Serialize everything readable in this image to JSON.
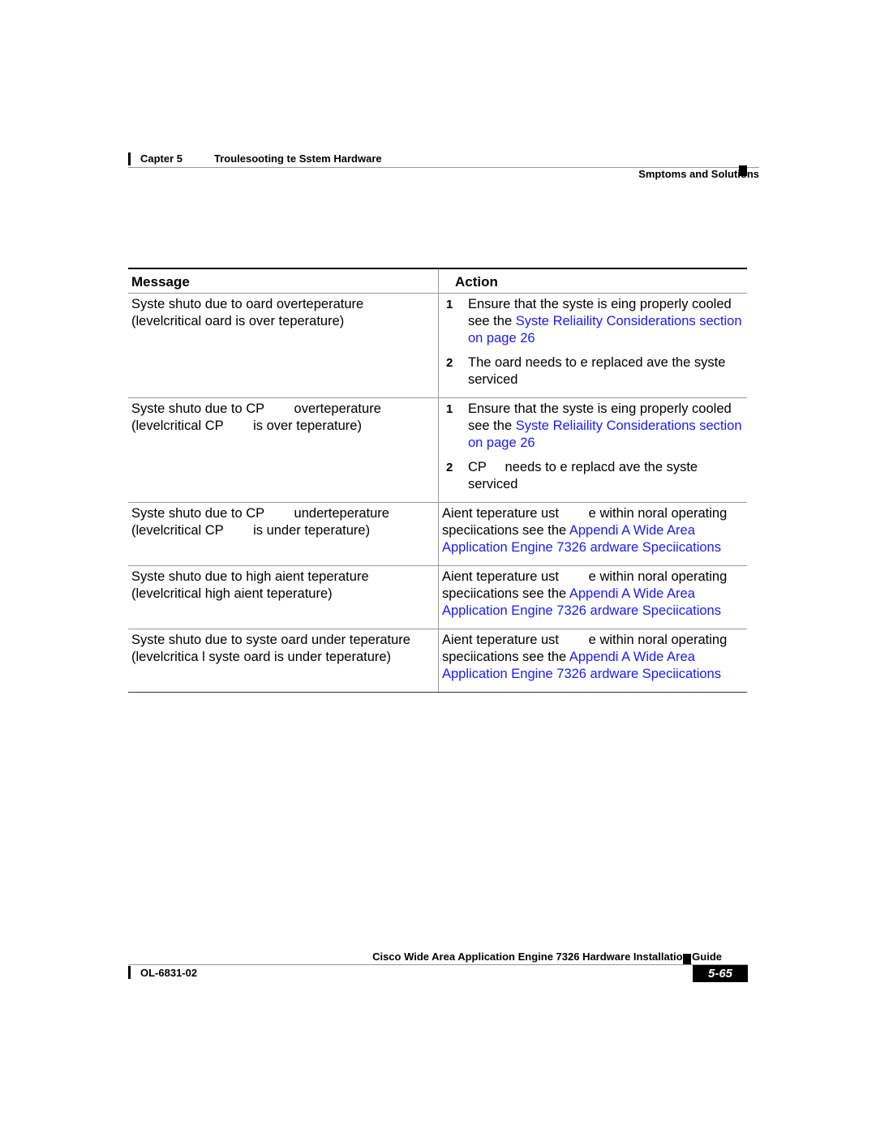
{
  "header": {
    "chapter": "Capter 5",
    "chapter_title": "Troulesooting te Sstem Hardware",
    "section": "Smptoms and Solutions"
  },
  "table": {
    "columns": [
      "Message",
      "Action"
    ],
    "rows": [
      {
        "message": "Syste shuto due to oard overteperature (levelcritical oard is over teperature)",
        "steps": [
          {
            "num": "1",
            "text": "Ensure that the syste is eing properly cooled see the ",
            "link": "Syste Reliaility Considerations section on page 26"
          },
          {
            "num": "2",
            "text": "The oard needs to e replaced ave the syste serviced",
            "link": ""
          }
        ]
      },
      {
        "message": "Syste shuto due to CP        overteperature (levelcritical CP        is over teperature)",
        "steps": [
          {
            "num": "1",
            "text": "Ensure that the syste is eing properly cooled see the ",
            "link": "Syste Reliaility Considerations section on page 26"
          },
          {
            "num": "2",
            "text": "CP     needs to e replacd ave the syste serviced",
            "link": ""
          }
        ]
      },
      {
        "message": "Syste shuto due to CP        underteperature (levelcritical CP        is under teperature)",
        "action_text": "Aient teperature ust        e within noral operating speciications see the ",
        "action_link": "Appendi A Wide Area Application Engine 7326 ardware Speciications"
      },
      {
        "message": "Syste shuto due to high aient teperature (levelcritical high aient teperature)",
        "action_text": "Aient teperature ust        e within noral operating speciications see the ",
        "action_link": "Appendi A Wide Area Application Engine 7326 ardware Speciications"
      },
      {
        "message": "Syste shuto due to syste oard under teperature (levelcritica l syste oard is under teperature)",
        "action_text": "Aient teperature ust        e within noral operating speciications see the ",
        "action_link": "Appendi A Wide Area Application Engine 7326 ardware Speciications"
      }
    ]
  },
  "footer": {
    "guide_title": "Cisco Wide Area Application Engine 7326 Hardware Installation Guide",
    "doc_number": "OL-6831-02",
    "page_number": "5-65"
  },
  "colors": {
    "link": "#1a1aff",
    "rule": "#999999"
  }
}
